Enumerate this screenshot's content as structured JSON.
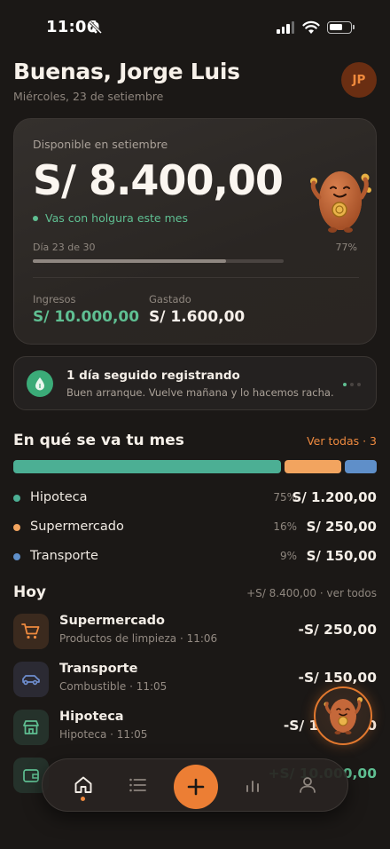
{
  "status_bar": {
    "time": "11:06"
  },
  "header": {
    "greeting": "Buenas, Jorge Luis",
    "date": "Miércoles, 23 de setiembre",
    "avatar_initials": "JP"
  },
  "balance_card": {
    "label": "Disponible en setiembre",
    "amount": "S/ 8.400,00",
    "status": "Vas con holgura este mes",
    "day_label": "Día 23 de 30",
    "percent_label": "77%",
    "progress": 0.77,
    "income_label": "Ingresos",
    "income_value": "S/ 10.000,00",
    "spent_label": "Gastado",
    "spent_value": "S/ 1.600,00"
  },
  "streak": {
    "title": "1 día seguido registrando",
    "subtitle": "Buen arranque. Vuelve mañana y lo hacemos racha."
  },
  "spending": {
    "title": "En qué se va tu mes",
    "link": "Ver todas · 3",
    "categories": [
      {
        "name": "Hipoteca",
        "percent": "75%",
        "amount": "S/ 1.200,00",
        "share": 0.75,
        "color": "#4caf94"
      },
      {
        "name": "Supermercado",
        "percent": "16%",
        "amount": "S/ 250,00",
        "share": 0.16,
        "color": "#f2a45f"
      },
      {
        "name": "Transporte",
        "percent": "9%",
        "amount": "S/ 150,00",
        "share": 0.09,
        "color": "#5f8fc9"
      }
    ]
  },
  "today": {
    "title": "Hoy",
    "summary": "+S/ 8.400,00 · ver todos",
    "transactions": [
      {
        "name": "Supermercado",
        "detail": "Productos de limpieza · 11:06",
        "amount": "-S/ 250,00",
        "icon": "cart-icon"
      },
      {
        "name": "Transporte",
        "detail": "Combustible · 11:05",
        "amount": "-S/ 150,00",
        "icon": "car-icon"
      },
      {
        "name": "Hipoteca",
        "detail": "Hipoteca · 11:05",
        "amount": "-S/ 1.200,00",
        "icon": "house-icon"
      },
      {
        "name": "",
        "detail": "",
        "amount": "+S/ 10.000,00",
        "icon": "wallet-icon"
      }
    ]
  },
  "colors": {
    "accent": "#ef8a3f",
    "positive": "#5fbf92",
    "background": "#1b1816"
  }
}
